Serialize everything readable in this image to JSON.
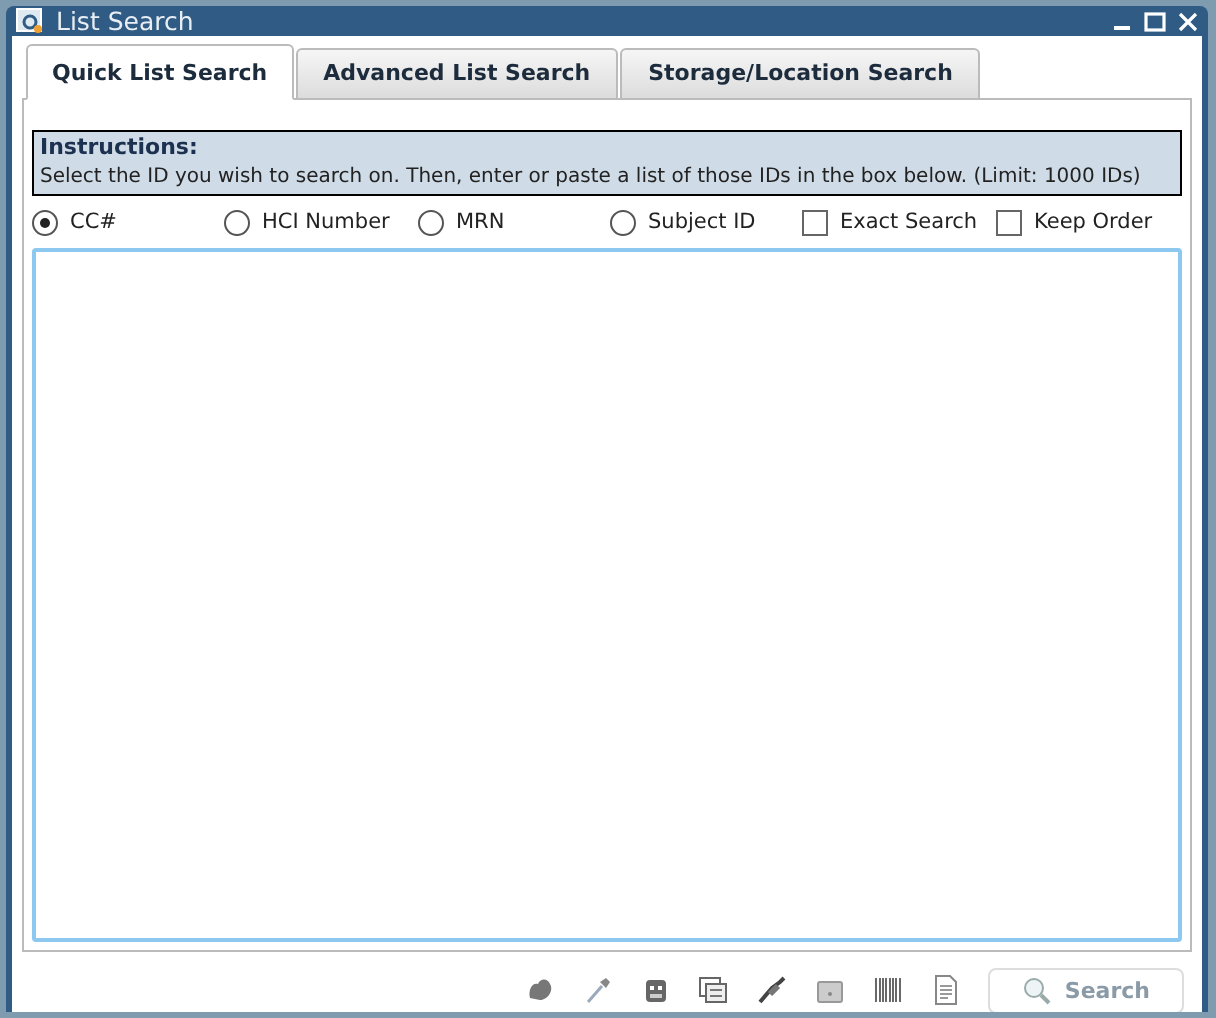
{
  "window": {
    "title": "List Search"
  },
  "tabs": [
    {
      "label": "Quick List Search",
      "selected": true
    },
    {
      "label": "Advanced List Search",
      "selected": false
    },
    {
      "label": "Storage/Location Search",
      "selected": false
    }
  ],
  "instructions": {
    "heading": "Instructions:",
    "text": "Select the ID you wish to search on. Then, enter or paste a list of those IDs in the box below. (Limit: 1000 IDs)"
  },
  "options": [
    {
      "kind": "radio",
      "label": "CC#",
      "selected": true
    },
    {
      "kind": "radio",
      "label": "HCI Number",
      "selected": false
    },
    {
      "kind": "radio",
      "label": "MRN",
      "selected": false
    },
    {
      "kind": "radio",
      "label": "Subject ID",
      "selected": false
    },
    {
      "kind": "checkbox",
      "label": "Exact Search",
      "checked": false
    },
    {
      "kind": "checkbox",
      "label": "Keep Order",
      "checked": false
    }
  ],
  "search_button": {
    "label": "Search",
    "disabled": true
  }
}
